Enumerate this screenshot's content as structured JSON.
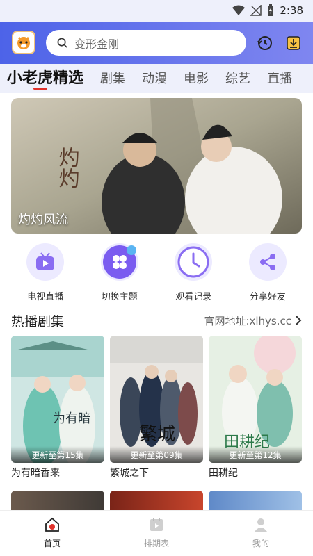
{
  "status_bar": {
    "time": "2:38"
  },
  "header": {
    "logo_icon": "tiger-logo-icon",
    "search_placeholder": "变形金刚",
    "history_icon": "history-icon",
    "download_icon": "download-icon"
  },
  "tabs": [
    {
      "label": "小老虎精选",
      "active": true
    },
    {
      "label": "剧集"
    },
    {
      "label": "动漫"
    },
    {
      "label": "电影"
    },
    {
      "label": "综艺"
    },
    {
      "label": "直播"
    }
  ],
  "banner": {
    "title": "灼灼风流"
  },
  "quick_actions": [
    {
      "label": "电视直播",
      "icon": "tv-icon"
    },
    {
      "label": "切换主题",
      "icon": "theme-icon"
    },
    {
      "label": "观看记录",
      "icon": "clock-icon"
    },
    {
      "label": "分享好友",
      "icon": "share-icon"
    }
  ],
  "section": {
    "title": "热播剧集",
    "link": "官网地址:xlhys.cc"
  },
  "dramas": [
    {
      "title": "为有暗香来",
      "badge": "更新至第15集"
    },
    {
      "title": "繁城之下",
      "badge": "更新至第09集"
    },
    {
      "title": "田耕纪",
      "badge": "更新至第12集"
    }
  ],
  "bottom_nav": [
    {
      "label": "首页",
      "icon": "home-icon",
      "active": true
    },
    {
      "label": "排期表",
      "icon": "calendar-icon"
    },
    {
      "label": "我的",
      "icon": "user-icon"
    }
  ],
  "colors": {
    "accent": "#4d63e8",
    "tab_indicator": "#e0322b",
    "icon_purple": "#7a5cf0"
  }
}
